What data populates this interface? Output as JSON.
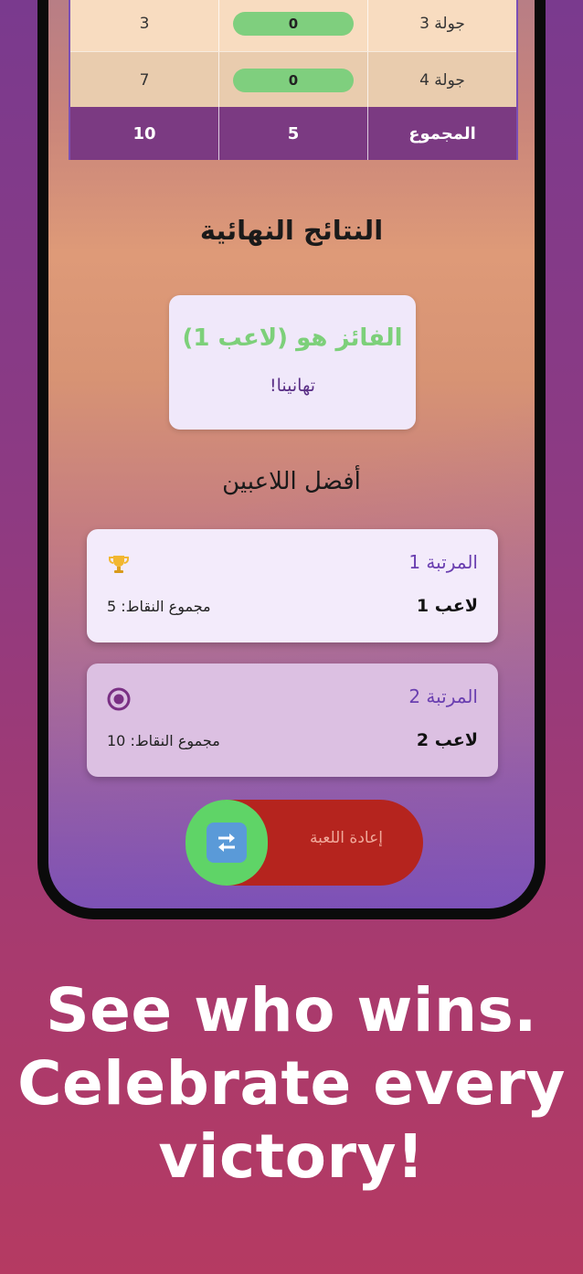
{
  "table": {
    "rows": [
      {
        "points": "3",
        "score": "0",
        "round": "جولة 3"
      },
      {
        "points": "7",
        "score": "0",
        "round": "جولة 4"
      }
    ],
    "total": {
      "points": "10",
      "score": "5",
      "label": "المجموع"
    }
  },
  "final_results_title": "النتائج النهائية",
  "winner": {
    "text": "الفائز هو (لاعب 1)",
    "congrats": "تهانينا!"
  },
  "top_players_title": "أفضل اللاعبين",
  "ranks": [
    {
      "label": "المرتبة 1",
      "player": "لاعب 1",
      "points": "مجموع النقاط: 5",
      "icon": "trophy-icon"
    },
    {
      "label": "المرتبة 2",
      "player": "لاعب 2",
      "points": "مجموع النقاط: 10",
      "icon": "radio-target-icon"
    }
  ],
  "replay_button": {
    "label": "إعادة اللعبة",
    "icon": "swap-arrows-icon"
  },
  "tagline": [
    "See who wins.",
    "Celebrate every",
    "victory!"
  ],
  "colors": {
    "accent": "#7b3a82",
    "winner": "#7dd07a",
    "replay": "#b5241e",
    "knob": "#5fd467"
  }
}
